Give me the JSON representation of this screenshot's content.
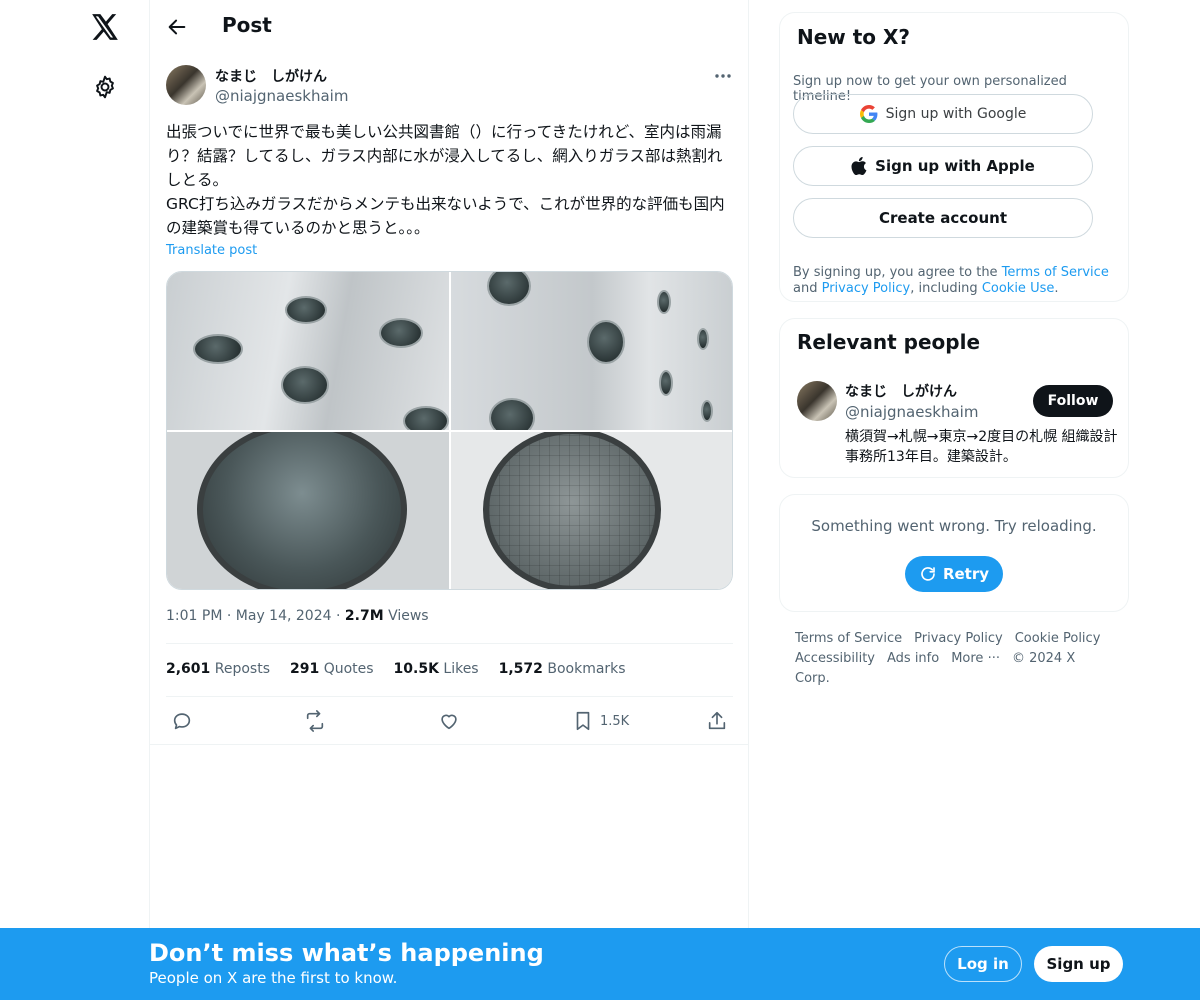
{
  "header": {
    "title": "Post"
  },
  "author": {
    "name": "なまじ　しがけん",
    "handle": "@niajgnaeskhaim"
  },
  "tweet": {
    "text": "出張ついでに世界で最も美しい公共図書館（）に行ってきたけれど、室内は雨漏り？結露？してるし、ガラス内部に水が浸入してるし、網入りガラス部は熱割れしとる。\nGRC打ち込みガラスだからメンテも出来ないようで、これが世界的な評価も国内の建築賞も得ているのかと思うと。。。",
    "translate": "Translate post",
    "time": "1:01 PM",
    "date": "May 14, 2024",
    "views_count": "2.7M",
    "views_label": "Views"
  },
  "stats": {
    "reposts_count": "2,601",
    "reposts_label": "Reposts",
    "quotes_count": "291",
    "quotes_label": "Quotes",
    "likes_count": "10.5K",
    "likes_label": "Likes",
    "bookmarks_count": "1,572",
    "bookmarks_label": "Bookmarks"
  },
  "actions": {
    "bookmark_count": "1.5K"
  },
  "signup": {
    "title": "New to X?",
    "subtitle": "Sign up now to get your own personalized timeline!",
    "google": "Sign up with Google",
    "apple": "Sign up with Apple",
    "create": "Create account",
    "legal_1": "By signing up, you agree to the ",
    "terms": "Terms of Service",
    "legal_2": " and ",
    "privacy": "Privacy Policy",
    "legal_3": ", including ",
    "cookie": "Cookie Use",
    "legal_4": "."
  },
  "people": {
    "title": "Relevant people",
    "name": "なまじ　しがけん",
    "handle": "@niajgnaeskhaim",
    "follow": "Follow",
    "bio": "横須賀→札幌→東京→2度目の札幌 組織設計事務所13年目。建築設計。"
  },
  "error": {
    "message": "Something went wrong. Try reloading.",
    "retry": "Retry"
  },
  "footer": {
    "terms": "Terms of Service",
    "privacy": "Privacy Policy",
    "cookie": "Cookie Policy",
    "accessibility": "Accessibility",
    "ads": "Ads info",
    "more": "More ···",
    "copyright": "© 2024 X Corp."
  },
  "bottom_bar": {
    "title": "Don’t miss what’s happening",
    "subtitle": "People on X are the first to know.",
    "login": "Log in",
    "signup": "Sign up"
  },
  "colors": {
    "accent": "#1d9bf0",
    "text": "#0f1419",
    "muted": "#536471"
  },
  "icons": [
    "x-logo-icon",
    "gear-icon",
    "back-arrow-icon",
    "more-icon",
    "reply-icon",
    "repost-icon",
    "like-icon",
    "bookmark-icon",
    "share-icon",
    "google-icon",
    "apple-icon",
    "retry-icon"
  ]
}
